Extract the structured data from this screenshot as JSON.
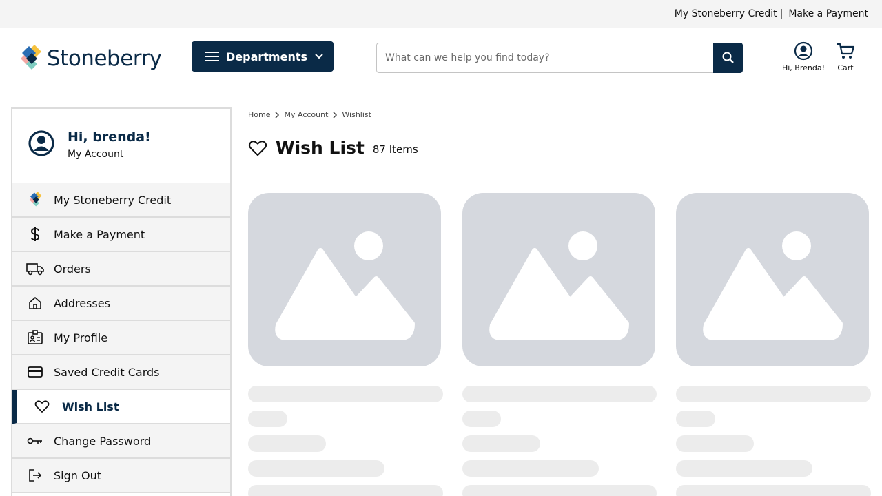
{
  "utility": {
    "credit_link": "My Stoneberry Credit",
    "separator": "|",
    "payment_link": "Make a Payment"
  },
  "header": {
    "logo_text": "Stoneberry",
    "departments_label": "Departments",
    "search_placeholder": "What can we help you find today?",
    "account_caption": "Hi, Brenda!",
    "cart_caption": "Cart"
  },
  "sidebar": {
    "greeting": "Hi, brenda!",
    "account_link": "My Account",
    "items": [
      {
        "label": "My Stoneberry Credit",
        "icon": "stoneberry-logo-icon"
      },
      {
        "label": "Make a Payment",
        "icon": "dollar-icon"
      },
      {
        "label": "Orders",
        "icon": "truck-icon"
      },
      {
        "label": "Addresses",
        "icon": "home-icon"
      },
      {
        "label": "My Profile",
        "icon": "id-card-icon"
      },
      {
        "label": "Saved Credit Cards",
        "icon": "credit-card-icon"
      },
      {
        "label": "Wish List",
        "icon": "heart-icon",
        "active": true
      },
      {
        "label": "Change Password",
        "icon": "key-icon"
      },
      {
        "label": "Sign Out",
        "icon": "sign-out-icon"
      }
    ]
  },
  "breadcrumb": [
    "Home",
    "My Account",
    "Wishlist"
  ],
  "page": {
    "title": "Wish List",
    "count": "87 Items"
  },
  "colors": {
    "brand_navy": "#0a2a47",
    "placeholder_gray": "#d5d8de",
    "skeleton_gray": "#ececec",
    "sidebar_bg": "#f4f4f4"
  }
}
